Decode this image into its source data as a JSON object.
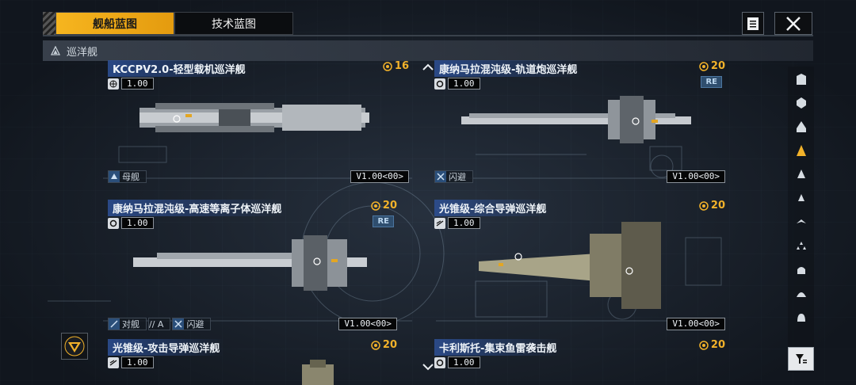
{
  "tabs": [
    {
      "label": "舰船蓝图",
      "active": true
    },
    {
      "label": "技术蓝图",
      "active": false
    }
  ],
  "category": {
    "label": "巡洋舰",
    "icon": "cruiser-class-icon"
  },
  "cards": [
    {
      "name": "KCCPV2.0-轻型载机巡洋舰",
      "cost": "16",
      "stat": "1.00",
      "stat_icon": "globe-icon",
      "re": "",
      "tags": [
        {
          "icon": "carrier-icon",
          "label": "母舰"
        }
      ],
      "version": "V1.00<00>"
    },
    {
      "name": "康纳马拉混沌级-轨道炮巡洋舰",
      "cost": "20",
      "stat": "1.00",
      "stat_icon": "gear-icon",
      "re": "RE",
      "tags": [
        {
          "icon": "evade-icon",
          "label": "闪避"
        }
      ],
      "version": "V1.00<00>"
    },
    {
      "name": "康纳马拉混沌级-高速等离子体巡洋舰",
      "cost": "20",
      "stat": "1.00",
      "stat_icon": "gear-icon",
      "re": "RE",
      "tags": [
        {
          "icon": "anti-ship-icon",
          "label": "对舰"
        },
        {
          "icon": "level-icon",
          "label": "// A"
        },
        {
          "icon": "evade-icon",
          "label": "闪避"
        }
      ],
      "version": "V1.00<00>"
    },
    {
      "name": "光锥级-综合导弹巡洋舰",
      "cost": "20",
      "stat": "1.00",
      "stat_icon": "missile-icon",
      "re": "",
      "tags": [],
      "version": "V1.00<00>"
    },
    {
      "name": "光锥级-攻击导弹巡洋舰",
      "cost": "20",
      "stat": "1.00",
      "stat_icon": "missile-icon",
      "re": "",
      "tags": [],
      "version": ""
    },
    {
      "name": "卡利斯托-集束鱼雷袭击舰",
      "cost": "20",
      "stat": "1.00",
      "stat_icon": "gear-icon",
      "re": "",
      "tags": [],
      "version": ""
    }
  ],
  "sidebar": {
    "icons": [
      "battleship-class-icon",
      "carrier-class-icon",
      "destroyer-class-icon",
      "cruiser-class-icon",
      "frigate-class-icon",
      "corvette-class-icon",
      "aircraft-class-icon",
      "squad-class-icon",
      "station-class-icon",
      "dome-class-icon",
      "base-class-icon"
    ],
    "active_index": 3
  },
  "colors": {
    "accent": "#f2b22a",
    "title_band": "#2d5096",
    "re_badge": "#2f4e6e"
  }
}
